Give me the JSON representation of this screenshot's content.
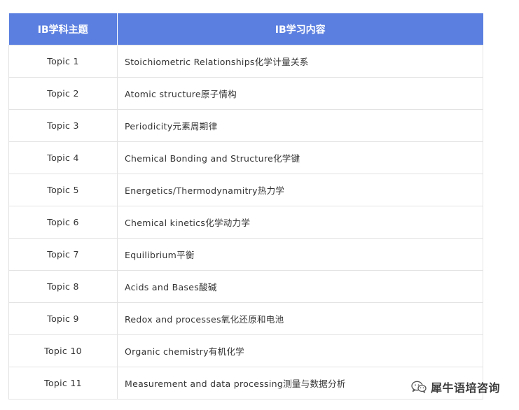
{
  "table": {
    "headers": [
      "IB学科主题",
      "IB学习内容"
    ],
    "rows": [
      {
        "topic": "Topic 1",
        "content": "Stoichiometric Relationships化学计量关系"
      },
      {
        "topic": "Topic 2",
        "content": "Atomic structure原子情构"
      },
      {
        "topic": "Topic 3",
        "content": "Periodicity元素周期律"
      },
      {
        "topic": "Topic 4",
        "content": "Chemical Bonding and Structure化学键"
      },
      {
        "topic": "Topic 5",
        "content": "Energetics/Thermodynamitry热力学"
      },
      {
        "topic": "Topic 6",
        "content": "Chemical kinetics化学动力学"
      },
      {
        "topic": "Topic 7",
        "content": "Equilibrium平衡"
      },
      {
        "topic": "Topic 8",
        "content": "Acids and Bases酸碱"
      },
      {
        "topic": "Topic 9",
        "content": "Redox and processes氧化还原和电池"
      },
      {
        "topic": "Topic 10",
        "content": "Organic chemistry有机化学"
      },
      {
        "topic": "Topic 11",
        "content": "Measurement and data processing测量与数据分析"
      }
    ]
  },
  "watermark": {
    "icon": "wechat-icon",
    "text": "犀牛语培咨询"
  },
  "colors": {
    "header_bg": "#5b7fe0",
    "header_text": "#ffffff",
    "cell_border": "#e3e3e3",
    "cell_text": "#333333"
  }
}
